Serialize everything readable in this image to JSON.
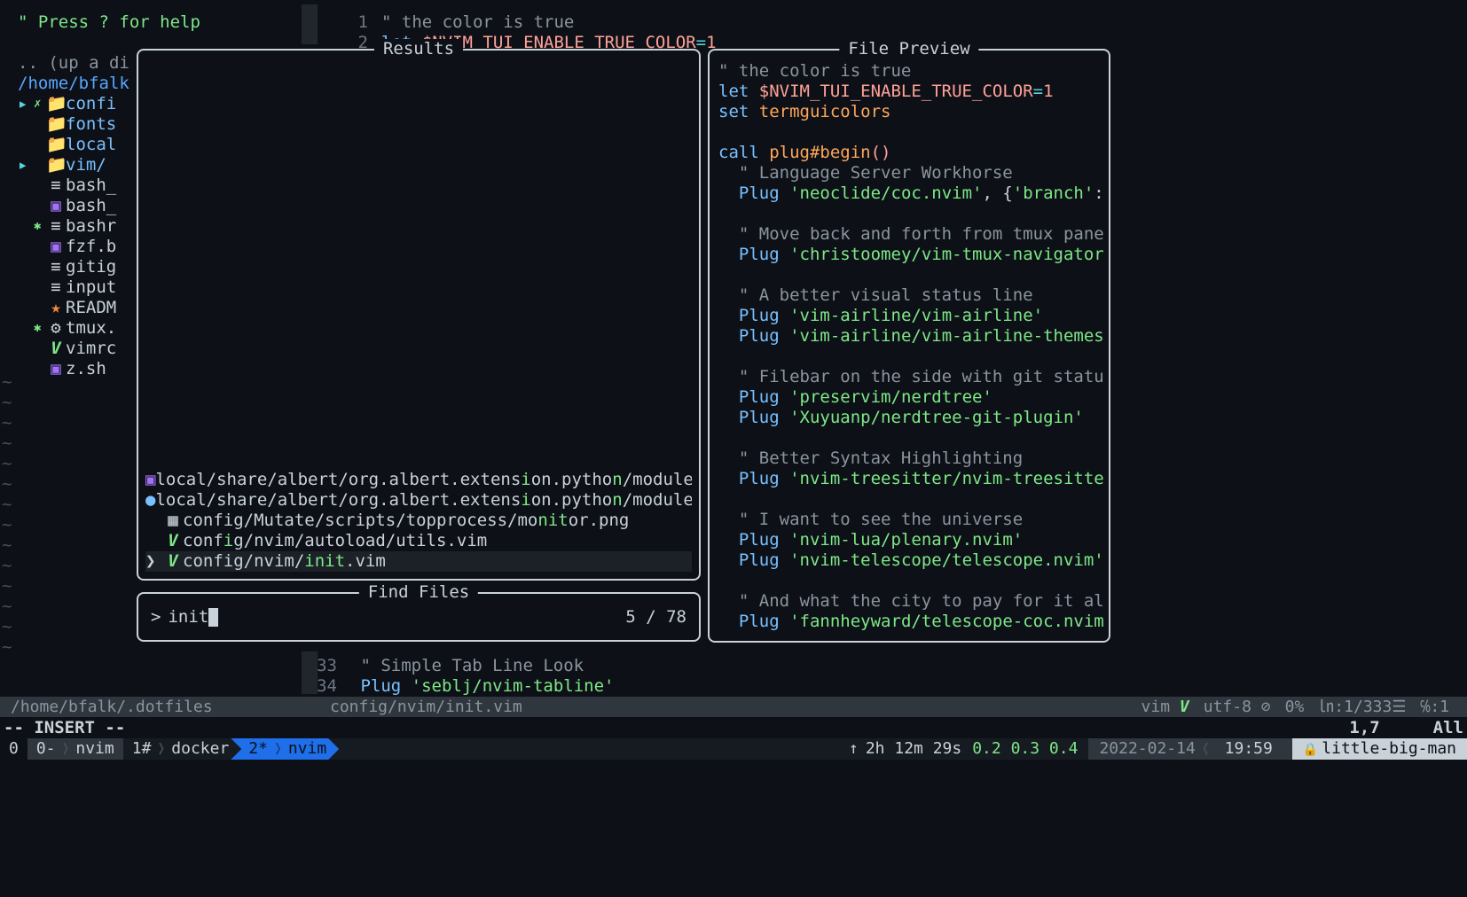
{
  "top_hint": "\" Press ? for help",
  "editor_top": {
    "lines": [
      {
        "num": "1",
        "content_html": "<span class='comment-grey'>\" the color is true</span>"
      },
      {
        "num": "2",
        "content_html": "<span class='keyword-blue'>let</span> <span class='var-red'>$NVIM_TUI_ENABLE_TRUE_COLOR</span><span class='op-cyan'>=</span><span class='var-red'>1</span>"
      }
    ]
  },
  "nerdtree": {
    "up": ".. (up a di",
    "path": "/home/bfalk",
    "items": [
      {
        "arrow": "▸",
        "mod": "✗",
        "icon": "📁",
        "name": "confi",
        "folder": true,
        "iconcls": "nt-folder"
      },
      {
        "arrow": "",
        "mod": "",
        "icon": "📁",
        "name": "fonts",
        "folder": true,
        "iconcls": "nt-folder"
      },
      {
        "arrow": "",
        "mod": "",
        "icon": "📁",
        "name": "local",
        "folder": true,
        "iconcls": "nt-folder"
      },
      {
        "arrow": "▸",
        "mod": "",
        "icon": "📁",
        "name": "vim/",
        "folder": true,
        "iconcls": "nt-folder"
      },
      {
        "arrow": "",
        "mod": "",
        "icon": "≡",
        "name": "bash_",
        "folder": false,
        "iconcls": ""
      },
      {
        "arrow": "",
        "mod": "",
        "icon": "▣",
        "name": "bash_",
        "folder": false,
        "iconcls": "sh-icon"
      },
      {
        "arrow": "",
        "mod": "✱",
        "icon": "≡",
        "name": "bashr",
        "folder": false,
        "iconcls": ""
      },
      {
        "arrow": "",
        "mod": "",
        "icon": "▣",
        "name": "fzf.b",
        "folder": false,
        "iconcls": "sh-icon"
      },
      {
        "arrow": "",
        "mod": "",
        "icon": "≡",
        "name": "gitig",
        "folder": false,
        "iconcls": ""
      },
      {
        "arrow": "",
        "mod": "",
        "icon": "≡",
        "name": "input",
        "folder": false,
        "iconcls": ""
      },
      {
        "arrow": "",
        "mod": "",
        "icon": "★",
        "name": "READM",
        "folder": false,
        "iconcls": "star-icon"
      },
      {
        "arrow": "",
        "mod": "✱",
        "icon": "⚙",
        "name": "tmux.",
        "folder": false,
        "iconcls": "gear-icon"
      },
      {
        "arrow": "",
        "mod": "",
        "icon": "V",
        "name": "vimrc",
        "folder": false,
        "iconcls": "v-icon"
      },
      {
        "arrow": "",
        "mod": "",
        "icon": "▣",
        "name": "z.sh",
        "folder": false,
        "iconcls": "sh-icon"
      }
    ]
  },
  "results": {
    "title": "Results",
    "items": [
      {
        "selected": false,
        "icon": "▣",
        "iconcls": "sh-icon",
        "path_html": "local/share/albert/org.albert.extens<span class='hl'>i</span>on.pytho<span class='hl'>n</span>/module"
      },
      {
        "selected": false,
        "icon": "●",
        "iconcls": "keyword-blue",
        "path_html": "local/share/albert/org.albert.extens<span class='hl'>i</span>on.pytho<span class='hl'>n</span>/module"
      },
      {
        "selected": false,
        "icon": "▦",
        "iconcls": "",
        "path_html": "config/Mutate/scripts/topprocess/mo<span class='hl'>nit</span>or.png"
      },
      {
        "selected": false,
        "icon": "V",
        "iconcls": "v-icon",
        "path_html": "conf<span class='hl'>i</span>g/nvim/autoload/utils.vim"
      },
      {
        "selected": true,
        "icon": "V",
        "iconcls": "v-icon",
        "path_html": "config/nvim/<span class='hl'>init</span>.vim"
      }
    ]
  },
  "find": {
    "title": "Find Files",
    "prompt": ">",
    "query": "init",
    "count": "5 / 78"
  },
  "preview": {
    "title": "File Preview",
    "lines_html": [
      "<span class='comment-grey'>\" the color is true</span>",
      "<span class='keyword-blue'>let</span> <span class='var-red'>$NVIM_TUI_ENABLE_TRUE_COLOR</span><span class='op-cyan'>=</span><span class='var-red'>1</span>",
      "<span class='keyword-blue'>set</span> <span class='func-orange'>termguicolors</span>",
      "",
      "<span class='keyword-blue'>call</span> <span class='func-orange'>plug#begin</span><span class='var-red'>()</span>",
      "  <span class='comment-grey'>\" Language Server Workhorse</span>",
      "  <span class='keyword-blue'>Plug</span> <span class='str-green'>'neoclide/coc.nvim'</span>, {<span class='str-green'>'branch'</span>: <span class='str-green'>'</span>",
      "",
      "  <span class='comment-grey'>\" Move back and forth from tmux panes</span>",
      "  <span class='keyword-blue'>Plug</span> <span class='str-green'>'christoomey/vim-tmux-navigator'</span>",
      "",
      "  <span class='comment-grey'>\" A better visual status line</span>",
      "  <span class='keyword-blue'>Plug</span> <span class='str-green'>'vim-airline/vim-airline'</span>",
      "  <span class='keyword-blue'>Plug</span> <span class='str-green'>'vim-airline/vim-airline-themes'</span>",
      "",
      "  <span class='comment-grey'>\" Filebar on the side with git status</span>",
      "  <span class='keyword-blue'>Plug</span> <span class='str-green'>'preservim/nerdtree'</span>",
      "  <span class='keyword-blue'>Plug</span> <span class='str-green'>'Xuyuanp/nerdtree-git-plugin'</span>",
      "",
      "  <span class='comment-grey'>\" Better Syntax Highlighting</span>",
      "  <span class='keyword-blue'>Plug</span> <span class='str-green'>'nvim-treesitter/nvim-treesitter'</span>",
      "",
      "  <span class='comment-grey'>\" I want to see the universe</span>",
      "  <span class='keyword-blue'>Plug</span> <span class='str-green'>'nvim-lua/plenary.nvim'</span>",
      "  <span class='keyword-blue'>Plug</span> <span class='str-green'>'nvim-telescope/telescope.nvim'</span>",
      "",
      "  <span class='comment-grey'>\" And what the city to pay for it all</span>",
      "  <span class='keyword-blue'>Plug</span> <span class='str-green'>'fannheyward/telescope-coc.nvim'</span>"
    ]
  },
  "editor_bottom": {
    "lines": [
      {
        "num": "33",
        "content_html": "  <span class='comment-grey'>\" Simple Tab Line Look</span>"
      },
      {
        "num": "34",
        "content_html": "  <span class='keyword-blue'>Plug</span> <span class='str-green'>'seblj/nvim-tabline'</span>"
      }
    ]
  },
  "statusline": {
    "left_path": "/home/bfalk/.dotfiles",
    "right_path": "config/nvim/init.vim",
    "filetype": "vim",
    "encoding": "utf-8",
    "percent": "0%",
    "position": "㏑:1/333☰",
    "col": "℅:1"
  },
  "mode": {
    "text": "-- INSERT --",
    "pos": "1,7",
    "scroll": "All"
  },
  "tmux": {
    "session": "0",
    "win_inactive_num": "0-",
    "win_inactive_name": "nvim",
    "win1_num": "1#",
    "win1_name": "docker",
    "win_active_num": "2*",
    "win_active_name": "nvim",
    "uptime": "2h 12m 29s",
    "load": "0.2 0.3 0.4",
    "date": "2022-02-14",
    "time": "19:59",
    "host": "little-big-man"
  }
}
